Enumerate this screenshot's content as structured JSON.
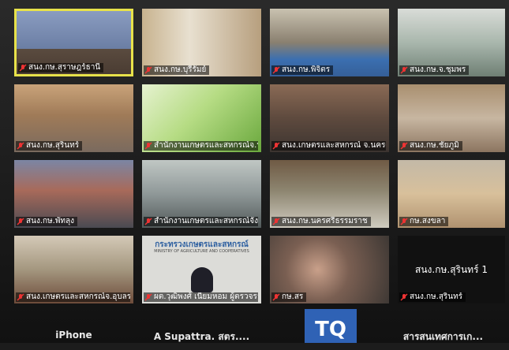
{
  "tiles": [
    {
      "label": "สนง.กษ.สุราษฎร์ธานี",
      "active": true,
      "bg": "#7c8fb5"
    },
    {
      "label": "สนง.กษ.บุรีรัมย์",
      "active": false,
      "bg": "#b9a58b"
    },
    {
      "label": "สนง.กษ.พิจิตร",
      "active": false,
      "bg": "#6a80a8"
    },
    {
      "label": "สนง.กษ.จ.ชุมพร",
      "active": false,
      "bg": "#8da596"
    },
    {
      "label": "สนง.กษ.สุรินทร์",
      "active": false,
      "bg": "#9c7b6c"
    },
    {
      "label": "สำนักงานเกษตรและสหกรณ์จ.น...",
      "active": false,
      "bg": "#9fc86b"
    },
    {
      "label": "สนง.เกษตรและสหกรณ์ จ.นครศ...",
      "active": false,
      "bg": "#7d6b5f"
    },
    {
      "label": "สนง.กษ.ชัยภูมิ",
      "active": false,
      "bg": "#a08a78"
    },
    {
      "label": "สนง.กษ.พัทลุง",
      "active": false,
      "bg": "#7c86a1"
    },
    {
      "label": "สำนักงานเกษตรและสหกรณ์จังห...",
      "active": false,
      "bg": "#9aa0a0"
    },
    {
      "label": "สนง.กษ.นครศรีธรรมราช",
      "active": false,
      "bg": "#7b7a6a"
    },
    {
      "label": "กษ.สงขลา",
      "active": false,
      "bg": "#b6a58c"
    },
    {
      "label": "สนง.เกษตรและสหกรณ์จ.อุบลราชธานี",
      "active": false,
      "bg": "#8f9486"
    },
    {
      "label": "ผต.วุฒิพงศ์ เนียมหอม ผู้ตรวจราชก...",
      "active": false,
      "bg": "#d9d9d6"
    },
    {
      "label": "กษ.สร",
      "active": false,
      "bg": "#6e6660"
    },
    {
      "label": "สนง.กษ.สุรินทร์",
      "active": false,
      "bg": "#111111",
      "big_name": "สนง.กษ.สุรินทร์ 1"
    }
  ],
  "ministry_banner": "กระทรวงเกษตรและสหกรณ์",
  "ministry_banner_en": "MINISTRY OF AGRICULTURE AND COOPERATIVES",
  "bottom": {
    "names": [
      "iPhone",
      "A Supattra. สตร....",
      "สารสนเทศการเก..."
    ],
    "avatar_initials": "TQ",
    "avatar_color": "#2f62b5"
  }
}
